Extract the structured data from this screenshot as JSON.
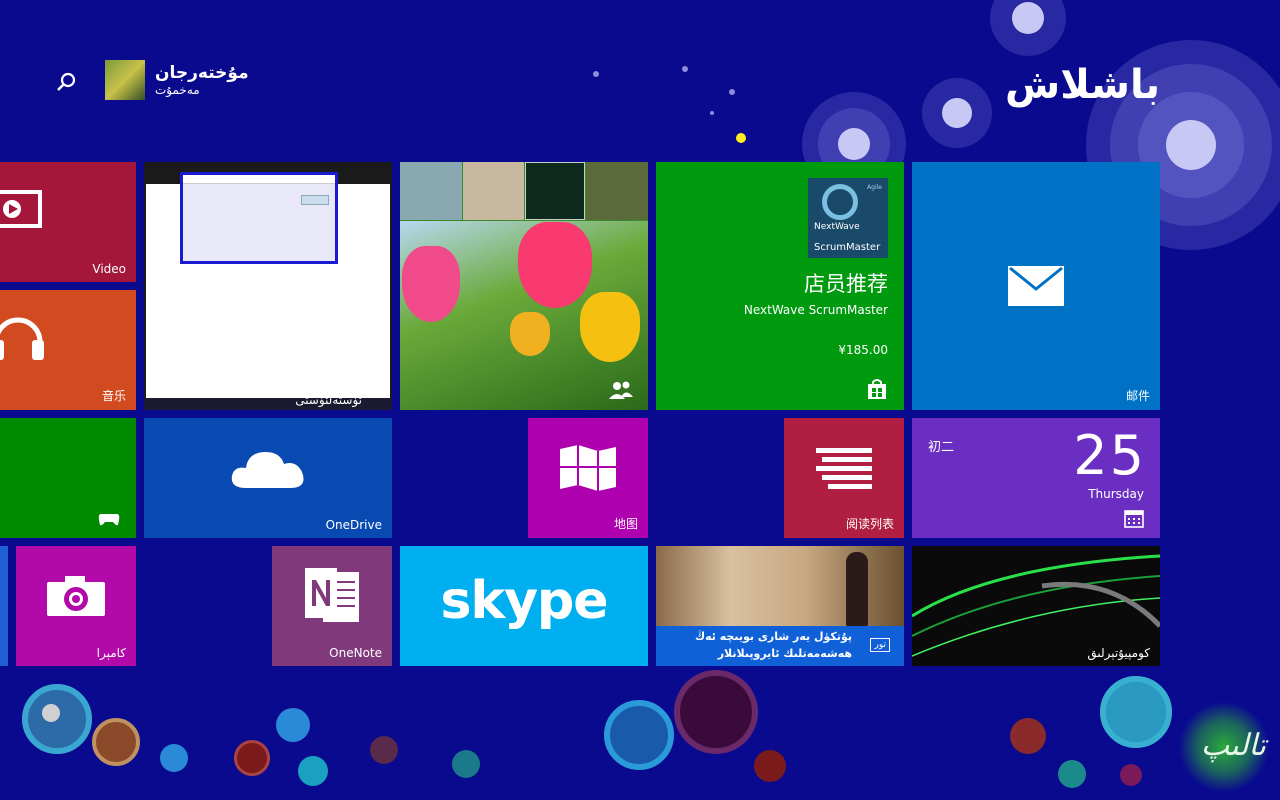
{
  "header": {
    "title": "باشلاش",
    "user_name": "مۇختەرجان",
    "user_sub": "مەخمۇت"
  },
  "tiles": {
    "video": {
      "label": "Video",
      "color": "#a4163a"
    },
    "music": {
      "label": "音乐",
      "color": "#d24a1f"
    },
    "games": {
      "label": "",
      "color": "#008a00"
    },
    "desktop": {
      "label": "ئۈستەلئۈستى"
    },
    "photos": {
      "label": ""
    },
    "store": {
      "category": "店员推荐",
      "app": "NextWave ScrumMaster",
      "price": "¥185.00",
      "logo_brand": "NextWave",
      "logo_product": "ScrumMaster",
      "logo_badge": "Agile",
      "color": "#009a0f"
    },
    "mail": {
      "label": "邮件",
      "color": "#0072c6"
    },
    "onedrive": {
      "label": "OneDrive",
      "color": "#094ab2"
    },
    "maps": {
      "label": "地图",
      "color": "#ae00ae"
    },
    "reading_list": {
      "label": "阅读列表",
      "color": "#b01e41"
    },
    "calendar": {
      "lunar": "初二",
      "date": "25",
      "weekday": "Thursday",
      "color": "#6b2ec3"
    },
    "camera": {
      "label": "كامېرا",
      "color": "#b10aa8"
    },
    "onenote": {
      "label": "OneNote",
      "color": "#80397b"
    },
    "skype": {
      "label": "skype",
      "color": "#00aff0"
    },
    "news": {
      "line1": "پۇتكۈل يەر شارى بويىچە ئەڭ",
      "line2": "ھەشەمەتلىك ئايروپىلانلار",
      "tag": "تور"
    },
    "wallpaper": {
      "label": "كومپيۇتېرلىق"
    }
  },
  "watermark": {
    "text": "تالىپ"
  }
}
